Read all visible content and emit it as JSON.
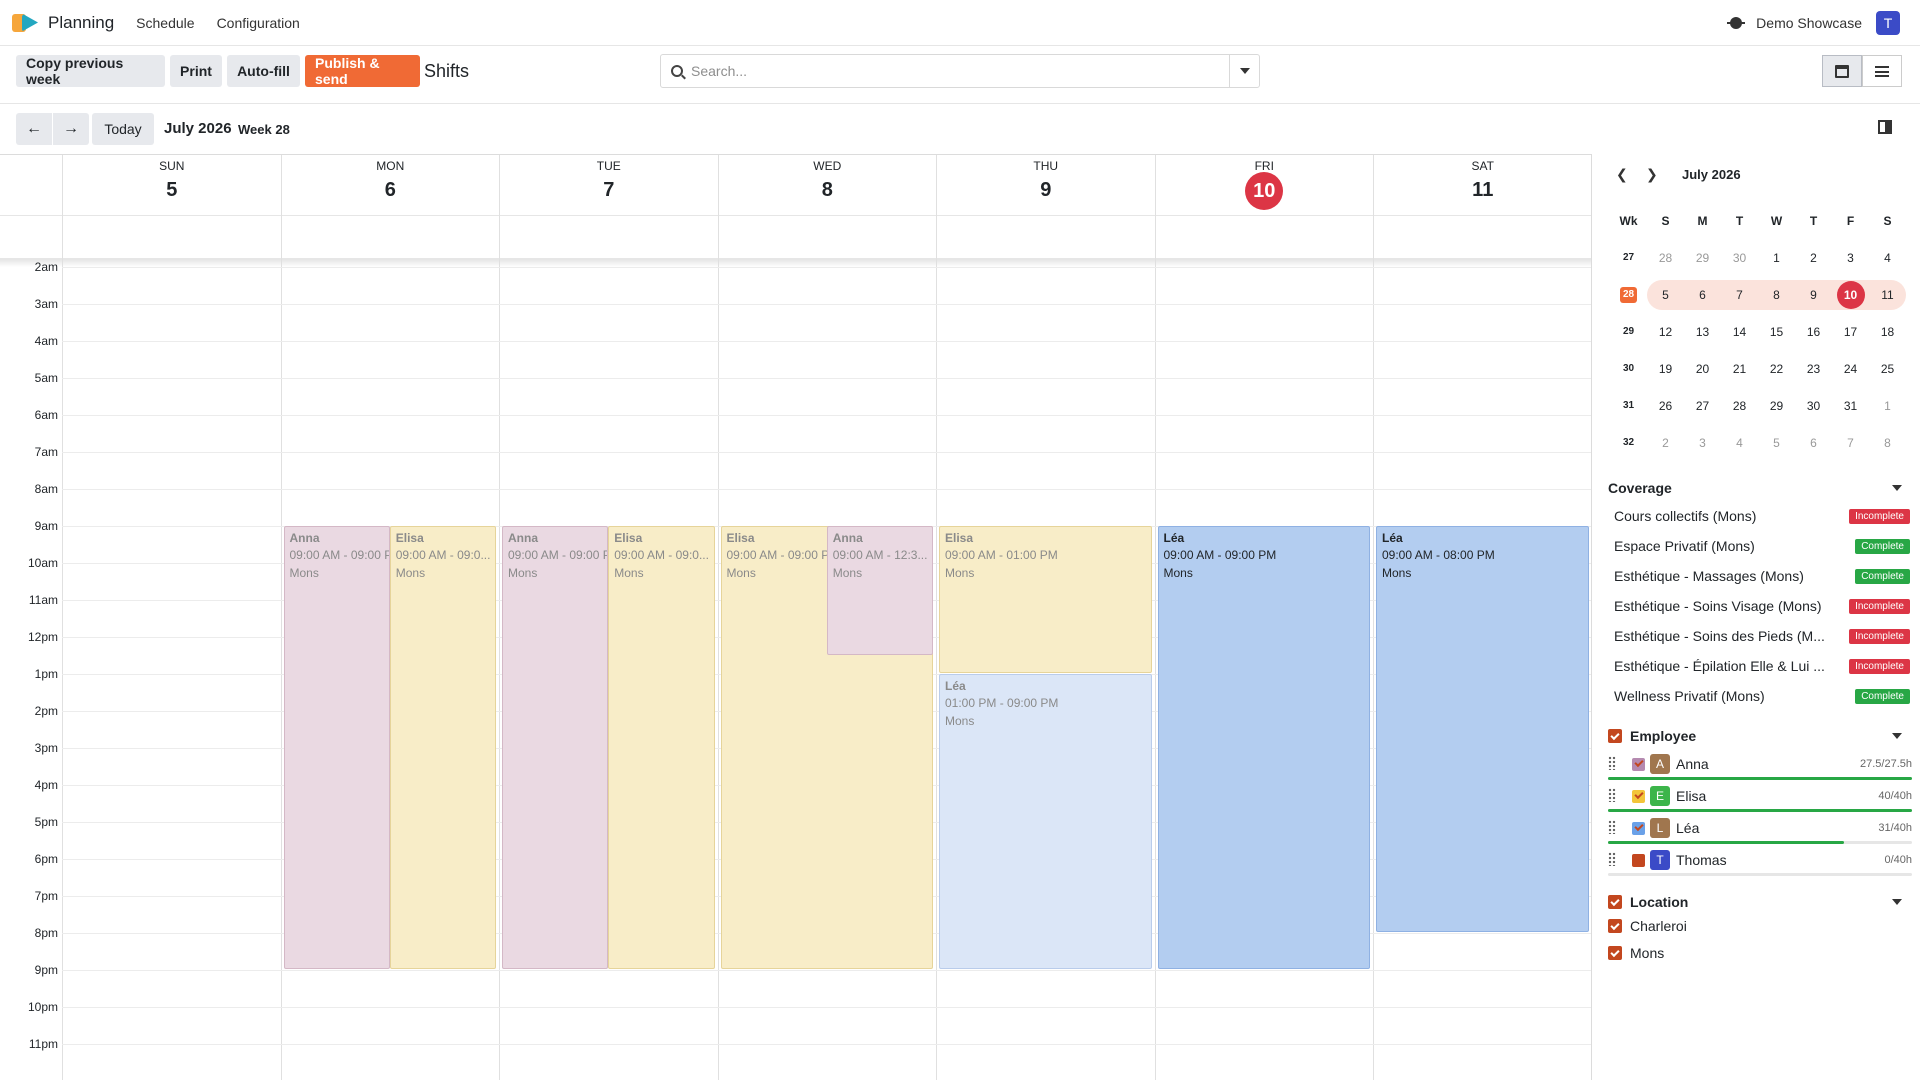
{
  "navbar": {
    "app_name": "Planning",
    "menu": [
      "Schedule",
      "Configuration"
    ],
    "company": "Demo Showcase",
    "user_initial": "T"
  },
  "control": {
    "buttons": [
      "Copy previous week",
      "Print",
      "Auto-fill",
      "Publish & send"
    ],
    "title": "Shifts",
    "search_placeholder": "Search...",
    "views": [
      "calendar-view-icon",
      "list-view-icon"
    ]
  },
  "toolbar": {
    "prev": "←",
    "next": "→",
    "today": "Today",
    "period": "July 2026",
    "week": "Week 28"
  },
  "calendar": {
    "days": [
      {
        "name": "SUN",
        "num": "5",
        "today": false
      },
      {
        "name": "MON",
        "num": "6",
        "today": false
      },
      {
        "name": "TUE",
        "num": "7",
        "today": false
      },
      {
        "name": "WED",
        "num": "8",
        "today": false
      },
      {
        "name": "THU",
        "num": "9",
        "today": false
      },
      {
        "name": "FRI",
        "num": "10",
        "today": true
      },
      {
        "name": "SAT",
        "num": "11",
        "today": false
      }
    ],
    "hours": [
      "2am",
      "3am",
      "4am",
      "5am",
      "6am",
      "7am",
      "8am",
      "9am",
      "10am",
      "11am",
      "12pm",
      "1pm",
      "2pm",
      "3pm",
      "4pm",
      "5pm",
      "6pm",
      "7pm",
      "8pm",
      "9pm",
      "10pm",
      "11pm"
    ],
    "shifts": [
      {
        "day": 1,
        "slot": 0,
        "of": 2,
        "name": "Anna",
        "time": "09:00 AM - 09:00 PM",
        "location": "Mons",
        "start": 9,
        "end": 21,
        "color": "pink"
      },
      {
        "day": 1,
        "slot": 1,
        "of": 2,
        "name": "Elisa",
        "time": "09:00 AM - 09:0...",
        "location": "Mons",
        "start": 9,
        "end": 21,
        "color": "yellow"
      },
      {
        "day": 2,
        "slot": 0,
        "of": 2,
        "name": "Anna",
        "time": "09:00 AM - 09:00 PM",
        "location": "Mons",
        "start": 9,
        "end": 21,
        "color": "pink"
      },
      {
        "day": 2,
        "slot": 1,
        "of": 2,
        "name": "Elisa",
        "time": "09:00 AM - 09:0...",
        "location": "Mons",
        "start": 9,
        "end": 21,
        "color": "yellow"
      },
      {
        "day": 3,
        "slot": 0,
        "of": 1,
        "name": "Elisa",
        "time": "09:00 AM - 09:00 PM",
        "location": "Mons",
        "start": 9,
        "end": 21,
        "color": "yellow"
      },
      {
        "day": 3,
        "slot": 1,
        "of": 2,
        "name": "Anna",
        "time": "09:00 AM - 12:3...",
        "location": "Mons",
        "start": 9,
        "end": 12.5,
        "color": "pink"
      },
      {
        "day": 4,
        "slot": 0,
        "of": 1,
        "name": "Elisa",
        "time": "09:00 AM - 01:00 PM",
        "location": "Mons",
        "start": 9,
        "end": 13,
        "color": "yellow"
      },
      {
        "day": 4,
        "slot": 0,
        "of": 1,
        "name": "Léa",
        "time": "01:00 PM - 09:00 PM",
        "location": "Mons",
        "start": 13,
        "end": 21,
        "color": "lightblue"
      },
      {
        "day": 5,
        "slot": 0,
        "of": 1,
        "name": "Léa",
        "time": "09:00 AM - 09:00 PM",
        "location": "Mons",
        "start": 9,
        "end": 21,
        "color": "blue"
      },
      {
        "day": 6,
        "slot": 0,
        "of": 1,
        "name": "Léa",
        "time": "09:00 AM - 08:00 PM",
        "location": "Mons",
        "start": 9,
        "end": 20,
        "color": "blue"
      }
    ]
  },
  "minical": {
    "title": "July 2026",
    "headers": [
      "Wk",
      "S",
      "M",
      "T",
      "W",
      "T",
      "F",
      "S"
    ],
    "weeks": [
      {
        "wk": "27",
        "days": [
          "28",
          "29",
          "30",
          "1",
          "2",
          "3",
          "4"
        ],
        "muted": [
          0,
          1,
          2
        ]
      },
      {
        "wk": "28",
        "days": [
          "5",
          "6",
          "7",
          "8",
          "9",
          "10",
          "11"
        ],
        "muted": [],
        "current": true,
        "today_index": 5
      },
      {
        "wk": "29",
        "days": [
          "12",
          "13",
          "14",
          "15",
          "16",
          "17",
          "18"
        ],
        "muted": []
      },
      {
        "wk": "30",
        "days": [
          "19",
          "20",
          "21",
          "22",
          "23",
          "24",
          "25"
        ],
        "muted": []
      },
      {
        "wk": "31",
        "days": [
          "26",
          "27",
          "28",
          "29",
          "30",
          "31",
          "1"
        ],
        "muted": [
          6
        ]
      },
      {
        "wk": "32",
        "days": [
          "2",
          "3",
          "4",
          "5",
          "6",
          "7",
          "8"
        ],
        "muted": [
          0,
          1,
          2,
          3,
          4,
          5,
          6
        ]
      }
    ]
  },
  "coverage": {
    "title": "Coverage",
    "items": [
      {
        "name": "Cours collectifs (Mons)",
        "status": "Incomplete"
      },
      {
        "name": "Espace Privatif (Mons)",
        "status": "Complete"
      },
      {
        "name": "Esthétique - Massages (Mons)",
        "status": "Complete"
      },
      {
        "name": "Esthétique - Soins Visage (Mons)",
        "status": "Incomplete"
      },
      {
        "name": "Esthétique - Soins des Pieds (M...",
        "status": "Incomplete"
      },
      {
        "name": "Esthétique - Épilation Elle & Lui ...",
        "status": "Incomplete"
      },
      {
        "name": "Wellness Privatif (Mons)",
        "status": "Complete"
      }
    ]
  },
  "employees": {
    "title": "Employee",
    "items": [
      {
        "initial": "A",
        "name": "Anna",
        "hours": "27.5/27.5h",
        "progress": 1.0,
        "avatar_color": "#a0764e",
        "check_color": "#b58ab0"
      },
      {
        "initial": "E",
        "name": "Elisa",
        "hours": "40/40h",
        "progress": 1.0,
        "avatar_color": "#3cb54a",
        "check_color": "#f3c53a"
      },
      {
        "initial": "L",
        "name": "Léa",
        "hours": "31/40h",
        "progress": 0.775,
        "avatar_color": "#a0764e",
        "check_color": "#6aa1e8"
      },
      {
        "initial": "T",
        "name": "Thomas",
        "hours": "0/40h",
        "progress": 0.0,
        "avatar_color": "#3b4bc7",
        "check_color": "#c3471f"
      }
    ]
  },
  "locations": {
    "title": "Location",
    "items": [
      "Charleroi",
      "Mons"
    ]
  }
}
